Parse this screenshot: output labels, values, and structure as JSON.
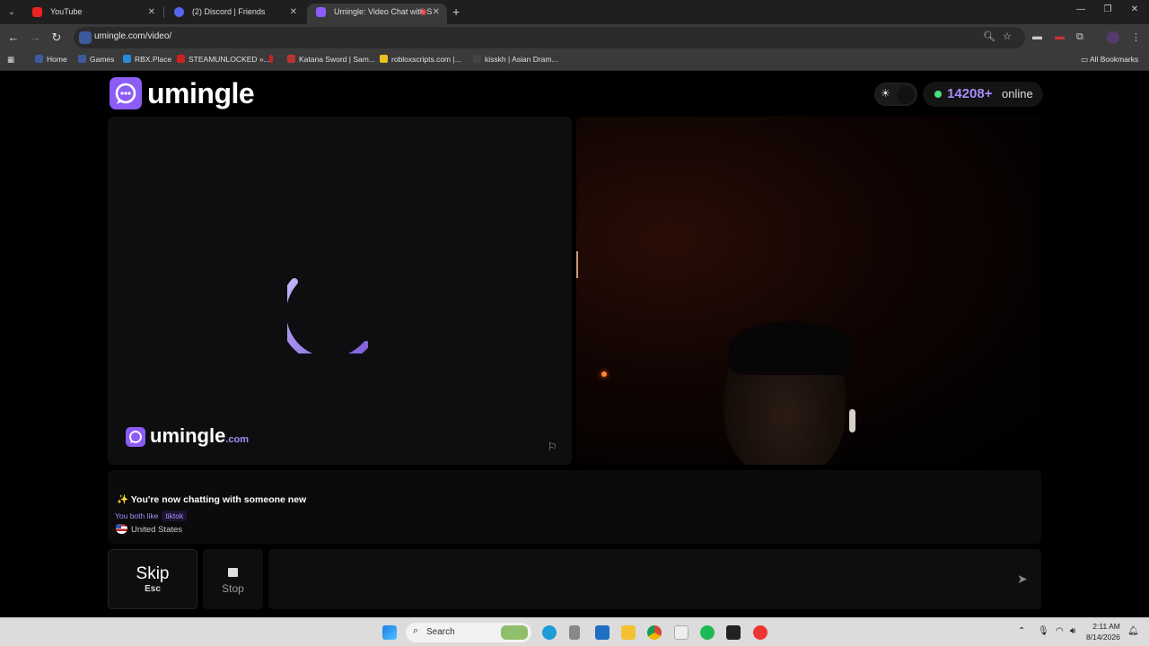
{
  "browser": {
    "tabs": [
      {
        "title": "YouTube",
        "active": false
      },
      {
        "title": "(2) Discord | Friends",
        "active": false
      },
      {
        "title": "Umingle: Video Chat with S",
        "active": true
      }
    ],
    "url": "umingle.com/video/",
    "bookmarks": [
      {
        "label": "Home"
      },
      {
        "label": "Games"
      },
      {
        "label": "RBX.Place"
      },
      {
        "label": "STEAMUNLOCKED »..."
      },
      {
        "label": ""
      },
      {
        "label": "Katana Sword | Sam..."
      },
      {
        "label": "robloxscripts.com |..."
      },
      {
        "label": "kisskh | Asian Dram..."
      }
    ],
    "all_bookmarks": "All Bookmarks"
  },
  "site": {
    "logo": "umingle",
    "online_count": "14208+",
    "online_label": "online",
    "watermark": "umingle",
    "watermark_suffix": ".com"
  },
  "chat": {
    "status": "✨ You're now chatting with someone new",
    "likes_label": "You both like",
    "likes_tag": "tiktok",
    "country": "United States"
  },
  "controls": {
    "skip_label": "Skip",
    "skip_key": "Esc",
    "stop_label": "Stop",
    "message_placeholder": ""
  },
  "taskbar": {
    "search_label": "Search",
    "time": "2:11 AM",
    "date": "8/14/2026"
  },
  "colors": {
    "accent": "#8b5cf6",
    "accent_light": "#a78bfa",
    "online_dot": "#4ade80"
  }
}
